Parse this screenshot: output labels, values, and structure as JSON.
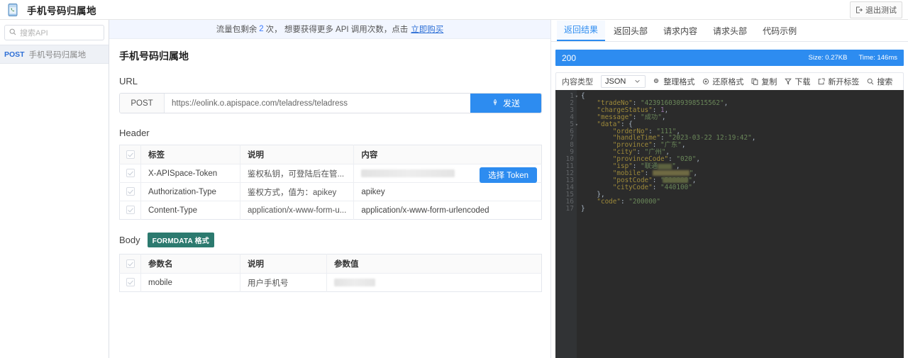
{
  "topbar": {
    "icon": "mobile-phone-icon",
    "title": "手机号码归属地",
    "logout_label": "退出测试",
    "logout_icon": "logout-icon"
  },
  "sidebar": {
    "search_placeholder": "搜索API",
    "search_icon": "search-icon",
    "api_items": [
      {
        "method": "POST",
        "name": "手机号码归属地"
      }
    ]
  },
  "notice": {
    "prefix": "流量包剩余",
    "count": "2",
    "middle": "次， 想要获得更多 API 调用次数，点击",
    "link": "立即购买"
  },
  "main": {
    "page_title": "手机号码归属地",
    "url_label": "URL",
    "method": "POST",
    "url": "https://eolink.o.apispace.com/teladress/teladress",
    "send_label": "发送",
    "send_icon": "rocket-icon",
    "header_label": "Header",
    "header_table": {
      "columns": [
        "标签",
        "说明",
        "内容"
      ],
      "rows": [
        {
          "tag": "X-APISpace-Token",
          "desc": "鉴权私钥，可登陆后在管...",
          "value": "",
          "redacted": true,
          "action": "选择 Token"
        },
        {
          "tag": "Authorization-Type",
          "desc": "鉴权方式，值为：apikey",
          "value": "apikey",
          "redacted": false,
          "action": ""
        },
        {
          "tag": "Content-Type",
          "desc": "application/x-www-form-u...",
          "value": "application/x-www-form-urlencoded",
          "redacted": false,
          "action": ""
        }
      ]
    },
    "body_label": "Body",
    "body_badge": "FORMDATA 格式",
    "body_table": {
      "columns": [
        "参数名",
        "说明",
        "参数值"
      ],
      "rows": [
        {
          "name": "mobile",
          "desc": "用户手机号",
          "value": "",
          "redacted": true
        }
      ]
    }
  },
  "response": {
    "tabs": [
      {
        "label": "返回结果",
        "active": true
      },
      {
        "label": "返回头部",
        "active": false
      },
      {
        "label": "请求内容",
        "active": false
      },
      {
        "label": "请求头部",
        "active": false
      },
      {
        "label": "代码示例",
        "active": false
      }
    ],
    "status_code": "200",
    "size": "Size: 0.27KB",
    "time": "Time: 146ms",
    "status_color": "#2d8cf0",
    "toolbar": {
      "content_type_label": "内容类型",
      "content_type_value": "JSON",
      "chevron_icon": "chevron-down-icon",
      "buttons": [
        {
          "label": "整理格式",
          "icon": "format-icon"
        },
        {
          "label": "还原格式",
          "icon": "restore-icon"
        },
        {
          "label": "复制",
          "icon": "copy-icon"
        },
        {
          "label": "下载",
          "icon": "download-icon"
        },
        {
          "label": "新开标签",
          "icon": "new-tab-icon"
        },
        {
          "label": "搜索",
          "icon": "search-icon"
        }
      ]
    },
    "json_body": {
      "tradeNo": "4239160309398515562",
      "chargeStatus": "1",
      "message": "成功",
      "data": {
        "orderNo": "111",
        "handleTime": "2023-03-22 12:19:42",
        "province": "广东",
        "city": "广州",
        "provinceCode": "020",
        "isp": "联通",
        "mobile": "",
        "postCode": "510000",
        "cityCode": "440100"
      },
      "code": "200000"
    },
    "line_numbers": [
      "1",
      "2",
      "3",
      "4",
      "5",
      "6",
      "7",
      "8",
      "9",
      "10",
      "11",
      "12",
      "13",
      "14",
      "15",
      "16",
      "17"
    ]
  }
}
